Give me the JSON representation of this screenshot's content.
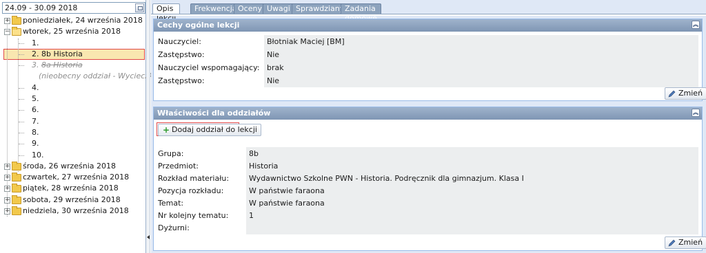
{
  "date_range": "24.09 - 30.09 2018",
  "tree": {
    "days": [
      {
        "label": "poniedziałek, 24 września 2018",
        "expanded": false
      },
      {
        "label": "wtorek, 25 września 2018",
        "expanded": true
      },
      {
        "label": "środa, 26 września 2018",
        "expanded": false
      },
      {
        "label": "czwartek, 27 września 2018",
        "expanded": false
      },
      {
        "label": "piątek, 28 września 2018",
        "expanded": false
      },
      {
        "label": "sobota, 29 września 2018",
        "expanded": false
      },
      {
        "label": "niedziela, 30 września 2018",
        "expanded": false
      }
    ],
    "lessons": [
      "1.",
      "2. 8b Historia",
      "3. 8a Historia",
      "4.",
      "5.",
      "6.",
      "7.",
      "8.",
      "9.",
      "10."
    ],
    "lesson3_prefix": "3. ",
    "lesson3_strike": "8a Historia",
    "cancel_note": "(nieobecny oddział - Wycieczka do..."
  },
  "tabs": [
    "Opis lekcji",
    "Frekwencja",
    "Oceny",
    "Uwagi",
    "Sprawdziany",
    "Zadania domowe"
  ],
  "general": {
    "title": "Cechy ogólne lekcji",
    "fields": [
      {
        "label": "Nauczyciel:",
        "value": "Błotniak Maciej [BM]"
      },
      {
        "label": "Zastępstwo:",
        "value": "Nie"
      },
      {
        "label": "Nauczyciel wspomagający:",
        "value": "brak"
      },
      {
        "label": "Zastępstwo:",
        "value": "Nie"
      }
    ],
    "change_label": "Zmień"
  },
  "classes": {
    "title": "Właściwości dla oddziałów",
    "add_label": "Dodaj oddział do lekcji",
    "fields": [
      {
        "label": "Grupa:",
        "value": "8b"
      },
      {
        "label": "Przedmiot:",
        "value": "Historia"
      },
      {
        "label": "Rozkład materiału:",
        "value": "Wydawnictwo Szkolne PWN - Historia. Podręcznik dla gimnazjum. Klasa I"
      },
      {
        "label": "Pozycja rozkładu:",
        "value": "W państwie faraona"
      },
      {
        "label": "Temat:",
        "value": "W państwie faraona"
      },
      {
        "label": "Nr kolejny tematu:",
        "value": "1"
      },
      {
        "label": "Dyżurni:",
        "value": ""
      }
    ],
    "change_label": "Zmień"
  },
  "colors": {
    "accent_header": "#8fa6c2",
    "selection": "#f9e7b0",
    "highlight_border": "#e04848"
  }
}
